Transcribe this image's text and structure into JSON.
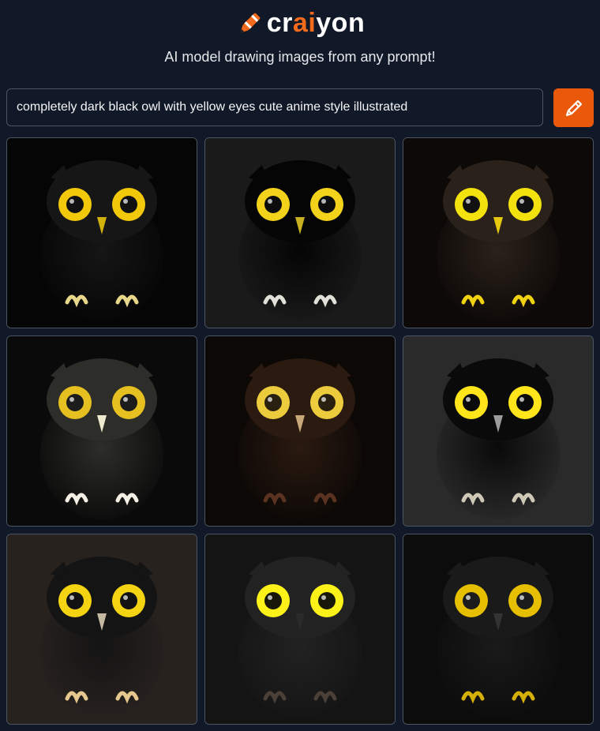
{
  "app": {
    "logo_parts": [
      "cr",
      "ai",
      "yon"
    ],
    "tagline": "AI model drawing images from any prompt!"
  },
  "search": {
    "value": "completely dark black owl with yellow eyes cute anime style illustrated",
    "button_icon": "pencil-icon"
  },
  "colors": {
    "background": "#111827",
    "accent": "#ea580c",
    "border": "#4b5563"
  },
  "results": [
    {
      "image": "owl-image",
      "bg": "#050505",
      "body": "#161616",
      "eye": "#f2c80a",
      "iris": "#111",
      "beak": "#d2b20a",
      "feet": "#e8d78a"
    },
    {
      "image": "owl-image",
      "bg": "#1a1a1a",
      "body": "#050505",
      "eye": "#f3d21b",
      "iris": "#0c0c0c",
      "beak": "#c8b020",
      "feet": "#e0e0d8"
    },
    {
      "image": "owl-image",
      "bg": "#0d0907",
      "body": "#2a211a",
      "eye": "#f4e20e",
      "iris": "#111",
      "beak": "#e6c80e",
      "feet": "#f0d20e"
    },
    {
      "image": "owl-image",
      "bg": "#0a0a0a",
      "body": "#2d2d29",
      "eye": "#e6c020",
      "iris": "#1c1c1c",
      "beak": "#f0ead0",
      "feet": "#f5f0e6"
    },
    {
      "image": "owl-image",
      "bg": "#0c0806",
      "body": "#2a1a10",
      "eye": "#eccc3c",
      "iris": "#2a2010",
      "beak": "#c8a878",
      "feet": "#5a3420"
    },
    {
      "image": "owl-image",
      "bg": "#2a2a2a",
      "body": "#0a0a0a",
      "eye": "#ffe51a",
      "iris": "#0a0a0a",
      "beak": "#9b9b9b",
      "feet": "#cfc8b6"
    },
    {
      "image": "owl-image",
      "bg": "#28221f",
      "body": "#141414",
      "eye": "#f4d312",
      "iris": "#121212",
      "beak": "#c4b8a0",
      "feet": "#e6c88e"
    },
    {
      "image": "owl-image",
      "bg": "#141414",
      "body": "#222222",
      "eye": "#fcf21a",
      "iris": "#181808",
      "beak": "#2a2a2a",
      "feet": "#4a4038"
    },
    {
      "image": "owl-image",
      "bg": "#0c0c0c",
      "body": "#1a1a1a",
      "eye": "#e6c000",
      "iris": "#1c1c1c",
      "beak": "#333",
      "feet": "#d4b006"
    }
  ]
}
